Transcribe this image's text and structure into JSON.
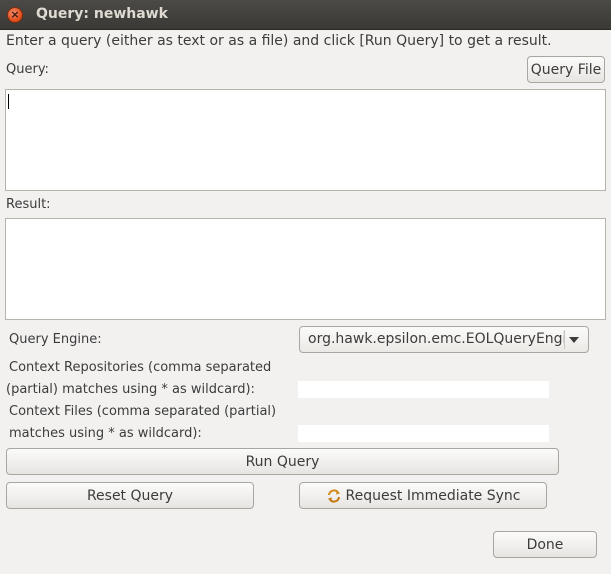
{
  "window": {
    "title": "Query: newhawk",
    "close_icon": "close-icon"
  },
  "instructions": "Enter a query (either as text or as a file) and click [Run Query] to get a result.",
  "query": {
    "label": "Query:",
    "value": "",
    "query_file_button": "Query File"
  },
  "result": {
    "label": "Result:",
    "value": ""
  },
  "query_engine": {
    "label": "Query Engine:",
    "selected": "org.hawk.epsilon.emc.EOLQueryEngine"
  },
  "context_repositories": {
    "label_line1": "Context Repositories (comma separated",
    "label_line2": "(partial) matches using * as wildcard):",
    "value": ""
  },
  "context_files": {
    "label_line1": "Context Files (comma separated (partial)",
    "label_line2": "matches using * as wildcard):",
    "value": ""
  },
  "buttons": {
    "run_query": "Run Query",
    "reset_query": "Reset Query",
    "request_sync": "Request Immediate Sync",
    "done": "Done"
  },
  "colors": {
    "titlebar": "#3c3b37",
    "close_button": "#df4b16",
    "window_background": "#f2f1f0"
  }
}
